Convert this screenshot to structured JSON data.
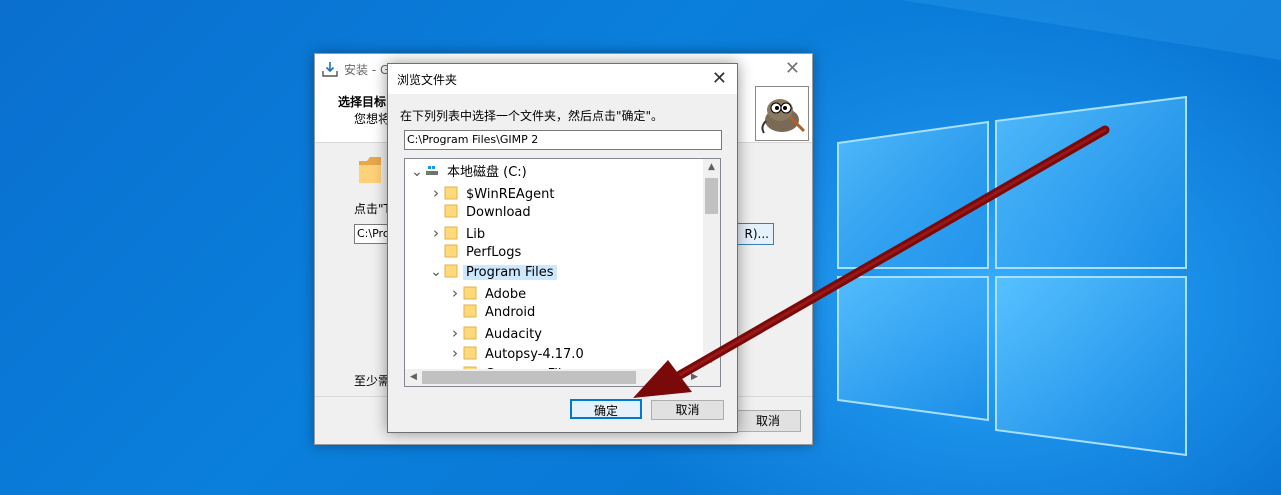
{
  "installer": {
    "title": "安装 - G",
    "header_title": "选择目标",
    "header_subtitle": "您想将",
    "click_text": "点击\"T",
    "path_value": "C:\\Pro",
    "browse_label": "R)...",
    "space_text": "至少需",
    "cancel_label": "取消",
    "icons": [
      "install-icon",
      "folder-icon",
      "gimp-logo",
      "close-icon"
    ]
  },
  "browse_dialog": {
    "title": "浏览文件夹",
    "instruction": "在下列列表中选择一个文件夹，然后点击\"确定\"。",
    "path": "C:\\Program Files\\GIMP 2",
    "tree": [
      {
        "label": "本地磁盘 (C:)",
        "level": 0,
        "expander": "expanded",
        "icon": "drive-icon"
      },
      {
        "label": "$WinREAgent",
        "level": 1,
        "expander": "collapsed",
        "icon": "folder-icon"
      },
      {
        "label": "Download",
        "level": 1,
        "expander": "none",
        "icon": "folder-icon"
      },
      {
        "label": "Lib",
        "level": 1,
        "expander": "collapsed",
        "icon": "folder-icon"
      },
      {
        "label": "PerfLogs",
        "level": 1,
        "expander": "none",
        "icon": "folder-icon"
      },
      {
        "label": "Program Files",
        "level": 1,
        "expander": "expanded",
        "icon": "folder-icon",
        "selected": true
      },
      {
        "label": "Adobe",
        "level": 2,
        "expander": "collapsed",
        "icon": "folder-icon"
      },
      {
        "label": "Android",
        "level": 2,
        "expander": "none",
        "icon": "folder-icon"
      },
      {
        "label": "Audacity",
        "level": 2,
        "expander": "collapsed",
        "icon": "folder-icon"
      },
      {
        "label": "Autopsy-4.17.0",
        "level": 2,
        "expander": "collapsed",
        "icon": "folder-icon"
      },
      {
        "label": "Common Files",
        "level": 2,
        "expander": "collapsed",
        "icon": "folder-icon"
      }
    ],
    "ok_label": "确定",
    "cancel_label": "取消"
  },
  "colors": {
    "desktop_blue": "#0a78d7",
    "selection": "#cce8ff",
    "annotation_arrow": "#7a0a0a",
    "default_button_border": "#0078d7"
  }
}
